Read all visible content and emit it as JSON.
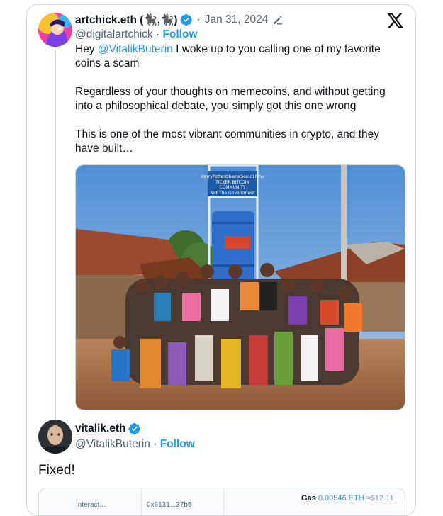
{
  "tweet": {
    "display_name": "artchick.eth (🐈‍⬛,🐈‍⬛)",
    "handle": "@digitalartchick",
    "date": "Jan 31, 2024",
    "separator": "·",
    "follow_label": "Follow",
    "mention": "@VitalikButerin",
    "text_before_mention": "Hey ",
    "text_after_mention": " I woke up to you calling one of my favorite coins a scam\n\nRegardless of your thoughts on memecoins, and without getting into a philosophical debate, you simply got this one wrong\n\nThis is one of the most vibrant communities in crypto, and they have built…",
    "photo": {
      "sign_lines": [
        "HarryPotterObamaSonic10Inu",
        "TICKER BITCOIN",
        "COMMUNITY",
        "Not The Government"
      ]
    }
  },
  "reply": {
    "display_name": "vitalik.eth",
    "handle": "@VitalikButerin",
    "separator": "·",
    "follow_label": "Follow",
    "text": "Fixed!",
    "embed": {
      "col1": "Interact...",
      "col2": "0x6131...37b5",
      "gas_label": "Gas",
      "gas_eth": "0.00546 ETH",
      "gas_usd": "≈$12.11"
    }
  },
  "colors": {
    "link": "#1d9bf0",
    "text": "#0f1419",
    "muted": "#536471",
    "border": "#cfd9de"
  }
}
